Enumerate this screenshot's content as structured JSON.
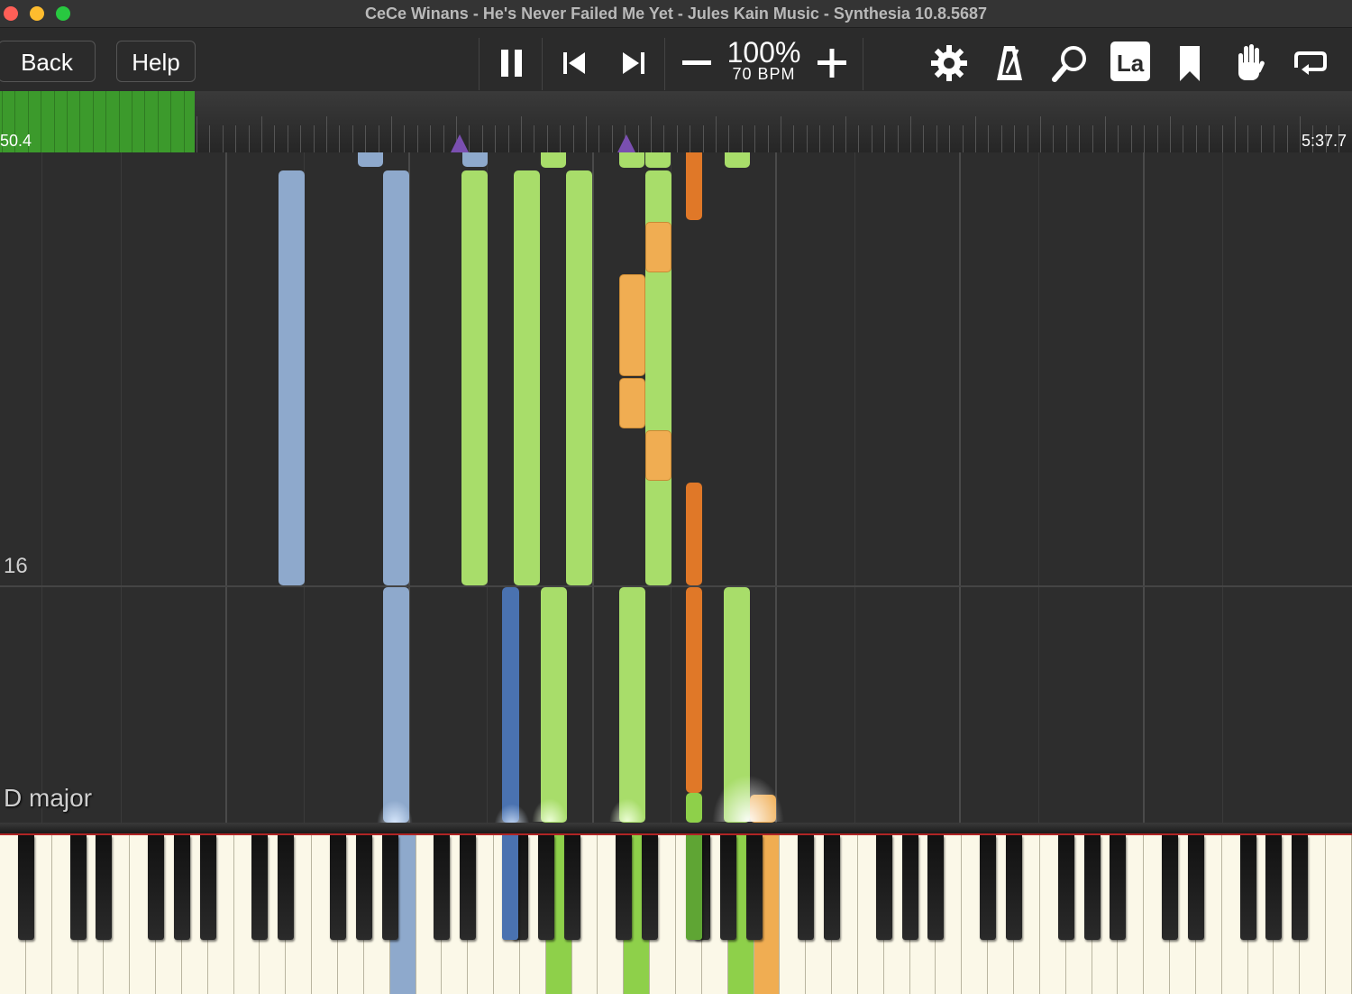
{
  "window": {
    "title": "CeCe Winans - He's Never Failed Me Yet - Jules Kain Music - Synthesia 10.8.5687",
    "traffic_lights": {
      "close": "#ff5f57",
      "minimize": "#febc2e",
      "zoom": "#28c840"
    }
  },
  "toolbar": {
    "back_label": "Back",
    "help_label": "Help",
    "speed_percent": "100%",
    "bpm": "70 BPM",
    "icons": [
      "pause-icon",
      "skip-back-icon",
      "skip-forward-icon",
      "minus-icon",
      "plus-icon",
      "gear-icon",
      "metronome-icon",
      "magnifier-icon",
      "la-labels-icon",
      "bookmark-icon",
      "hand-icon",
      "loop-icon"
    ],
    "la_label": "La"
  },
  "timeline": {
    "elapsed": "50.4",
    "total": "5:37.7",
    "progress_fraction": 0.144
  },
  "piano_roll": {
    "measure_number": "16",
    "key_signature": "D major",
    "colors": {
      "left_hand": "#8ea9cc",
      "left_hand_active": "#4a72b0",
      "right_hand": "#a8dd6a",
      "other_hand": "#f0ad52",
      "other_active": "#e07828"
    }
  },
  "keyboard": {
    "highlight_colors": [
      "#8ea9cc",
      "#4a72b0",
      "#8ed04a",
      "#f0ad52"
    ]
  }
}
